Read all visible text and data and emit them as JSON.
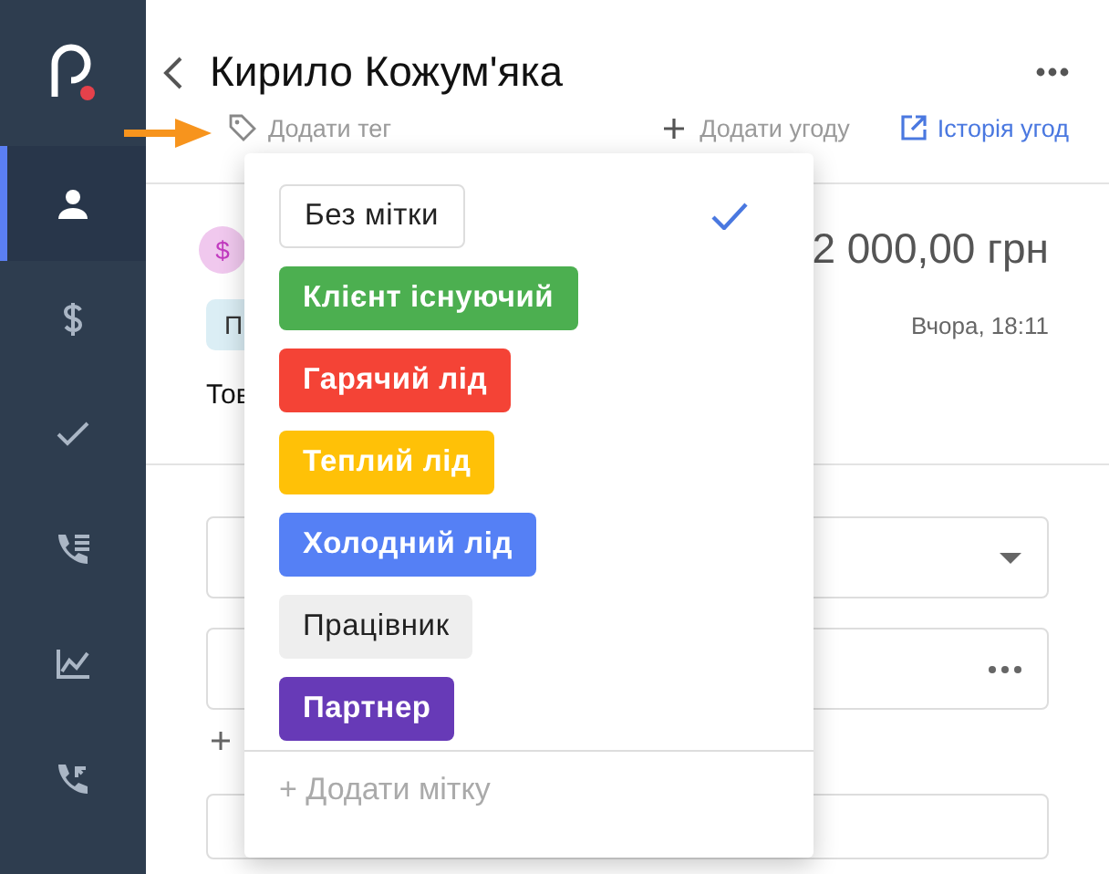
{
  "sidebar": {
    "items": [
      {
        "kind": "person",
        "selected": true
      },
      {
        "kind": "dollar",
        "selected": false
      },
      {
        "kind": "check",
        "selected": false
      },
      {
        "kind": "call-list",
        "selected": false
      },
      {
        "kind": "chart",
        "selected": false
      },
      {
        "kind": "call-back",
        "selected": false
      }
    ]
  },
  "header": {
    "title": "Кирило Кожум'яка",
    "tag_link": "Додати тег",
    "add_deal": "Додати угоду",
    "history": "Історія угод"
  },
  "deal": {
    "coin": "$",
    "amount": "2 000,00 грн",
    "chip": "П",
    "date": "Вчора, 18:11",
    "product": "Тов"
  },
  "fields": [
    {
      "kind": "select"
    },
    {
      "kind": "more"
    }
  ],
  "tag_menu": {
    "tags": [
      {
        "label": "Без мітки",
        "kind": "outlined",
        "color": "#ffffff",
        "selected": true
      },
      {
        "label": "Клієнт існуючий",
        "kind": "filled",
        "color": "#4caf50",
        "selected": false
      },
      {
        "label": "Гарячий лід",
        "kind": "filled",
        "color": "#f44336",
        "selected": false
      },
      {
        "label": "Теплий лід",
        "kind": "filled",
        "color": "#ffc107",
        "selected": false
      },
      {
        "label": "Холодний лід",
        "kind": "filled",
        "color": "#5580f5",
        "selected": false
      },
      {
        "label": "Працівник",
        "kind": "muted",
        "color": "#eeeeee",
        "selected": false
      },
      {
        "label": "Партнер",
        "kind": "filled",
        "color": "#673ab7",
        "selected": false
      }
    ],
    "add_label": "+ Додати мітку"
  }
}
